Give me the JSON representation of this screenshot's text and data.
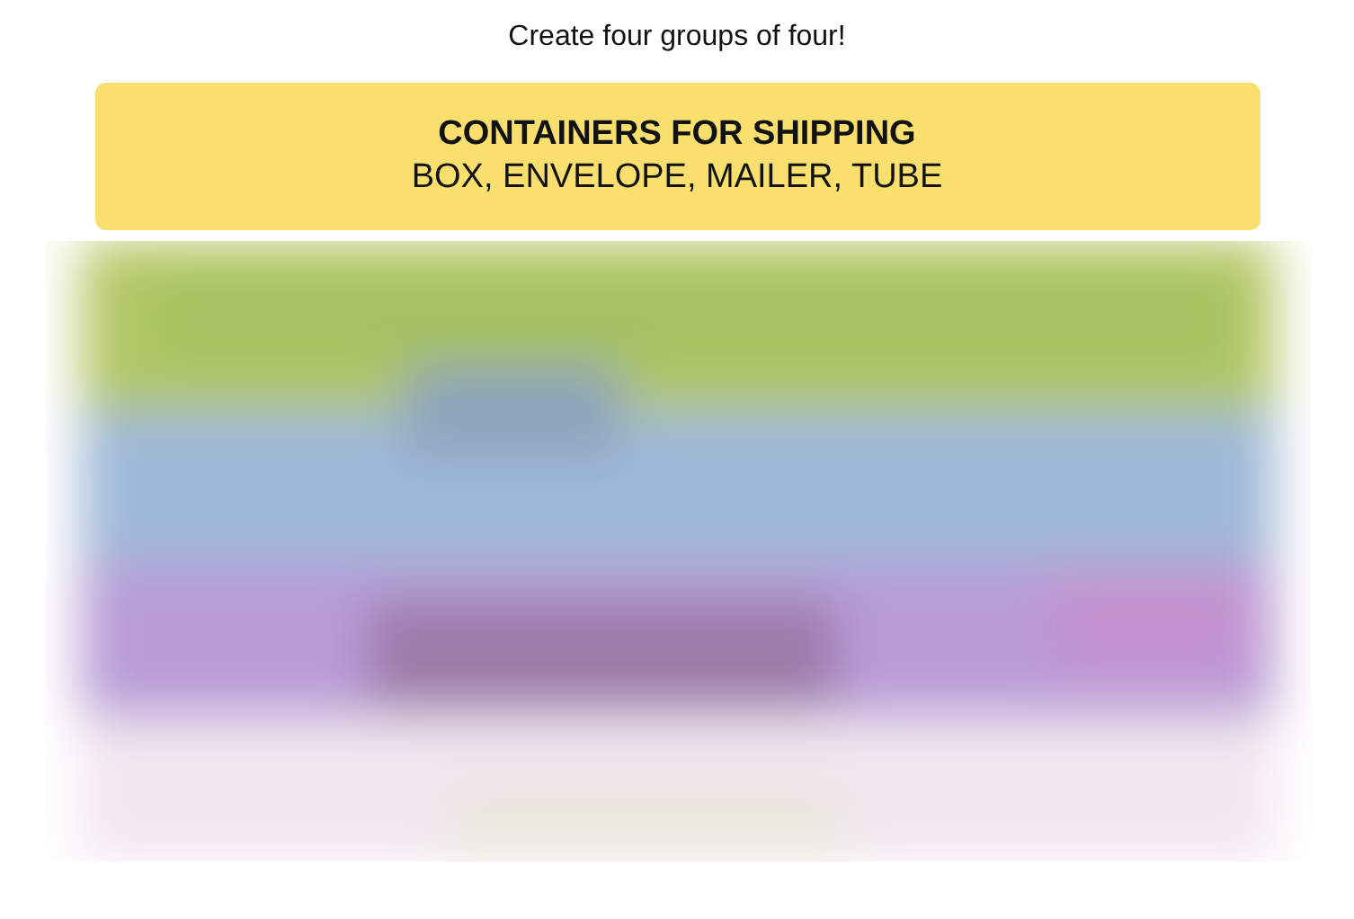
{
  "instruction": "Create four groups of four!",
  "solved_groups": [
    {
      "title": "CONTAINERS FOR SHIPPING",
      "members": "BOX, ENVELOPE, MAILER, TUBE",
      "color": "#f9df6d"
    }
  ]
}
